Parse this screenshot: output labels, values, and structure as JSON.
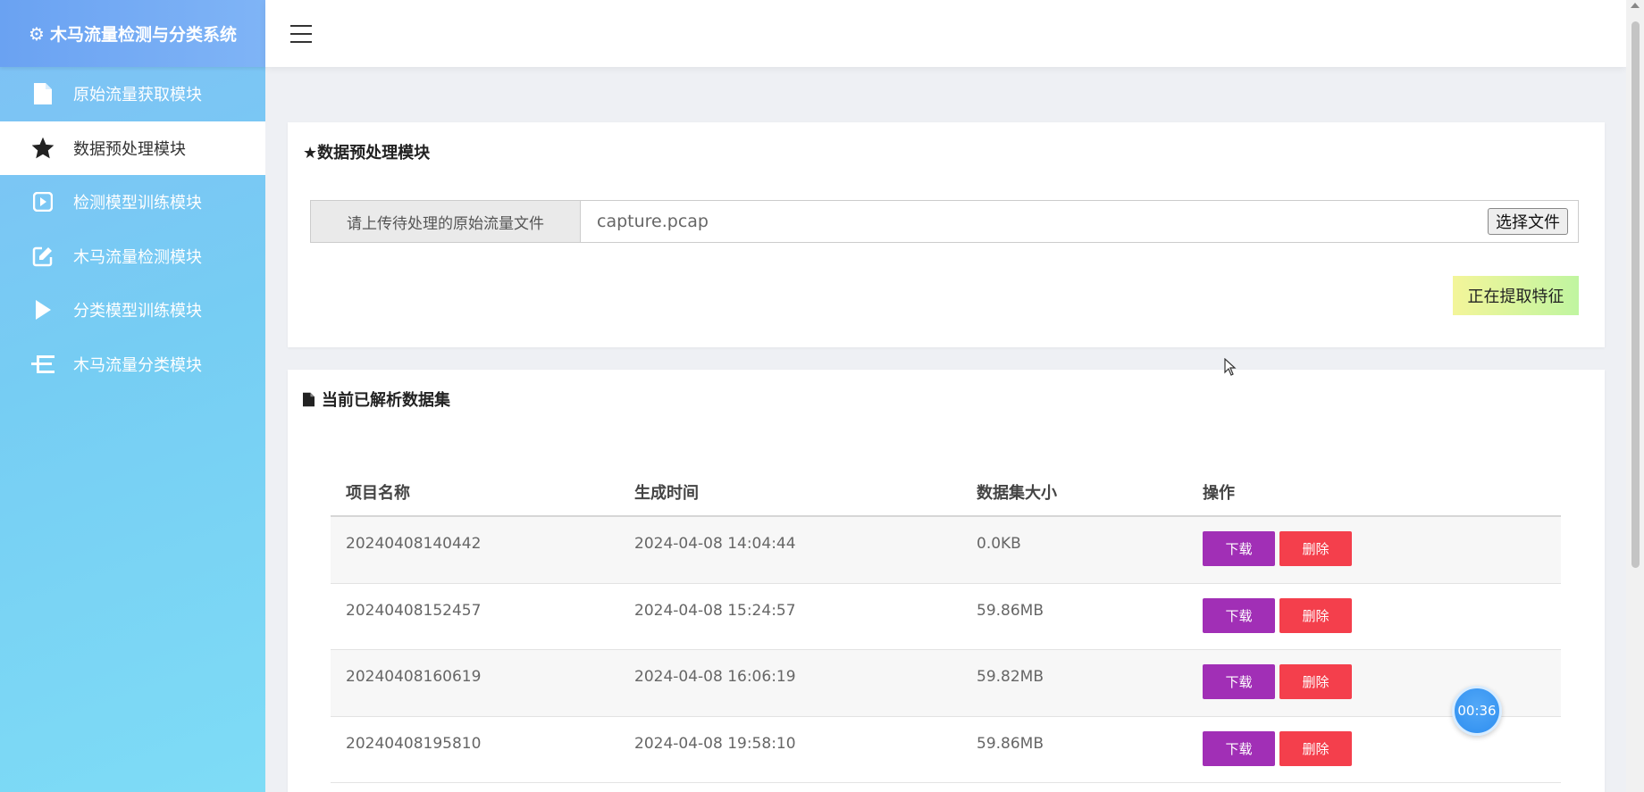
{
  "app": {
    "title": "木马流量检测与分类系统",
    "icon": "gear-icon"
  },
  "sidebar": {
    "items": [
      {
        "label": "原始流量获取模块",
        "icon": "file-icon"
      },
      {
        "label": "数据预处理模块",
        "icon": "star-icon",
        "active": true
      },
      {
        "label": "检测模型训练模块",
        "icon": "play-square-icon"
      },
      {
        "label": "木马流量检测模块",
        "icon": "edit-icon"
      },
      {
        "label": "分类模型训练模块",
        "icon": "play-icon"
      },
      {
        "label": "木马流量分类模块",
        "icon": "tree-icon"
      }
    ]
  },
  "preprocess": {
    "title": "★数据预处理模块",
    "upload_label": "请上传待处理的原始流量文件",
    "file_name": "capture.pcap",
    "choose_button": "选择文件",
    "status": "正在提取特征"
  },
  "datasets": {
    "title": "当前已解析数据集",
    "columns": [
      "项目名称",
      "生成时间",
      "数据集大小",
      "操作"
    ],
    "rows": [
      {
        "name": "20240408140442",
        "time": "2024-04-08 14:04:44",
        "size": "0.0KB"
      },
      {
        "name": "20240408152457",
        "time": "2024-04-08 15:24:57",
        "size": "59.86MB"
      },
      {
        "name": "20240408160619",
        "time": "2024-04-08 16:06:19",
        "size": "59.82MB"
      },
      {
        "name": "20240408195810",
        "time": "2024-04-08 19:58:10",
        "size": "59.86MB"
      }
    ],
    "download_label": "下载",
    "delete_label": "删除"
  },
  "timer": "00:36",
  "colors": {
    "download": "#a12fb6",
    "delete": "#f43f4c",
    "brand": "#6aa2f2"
  }
}
